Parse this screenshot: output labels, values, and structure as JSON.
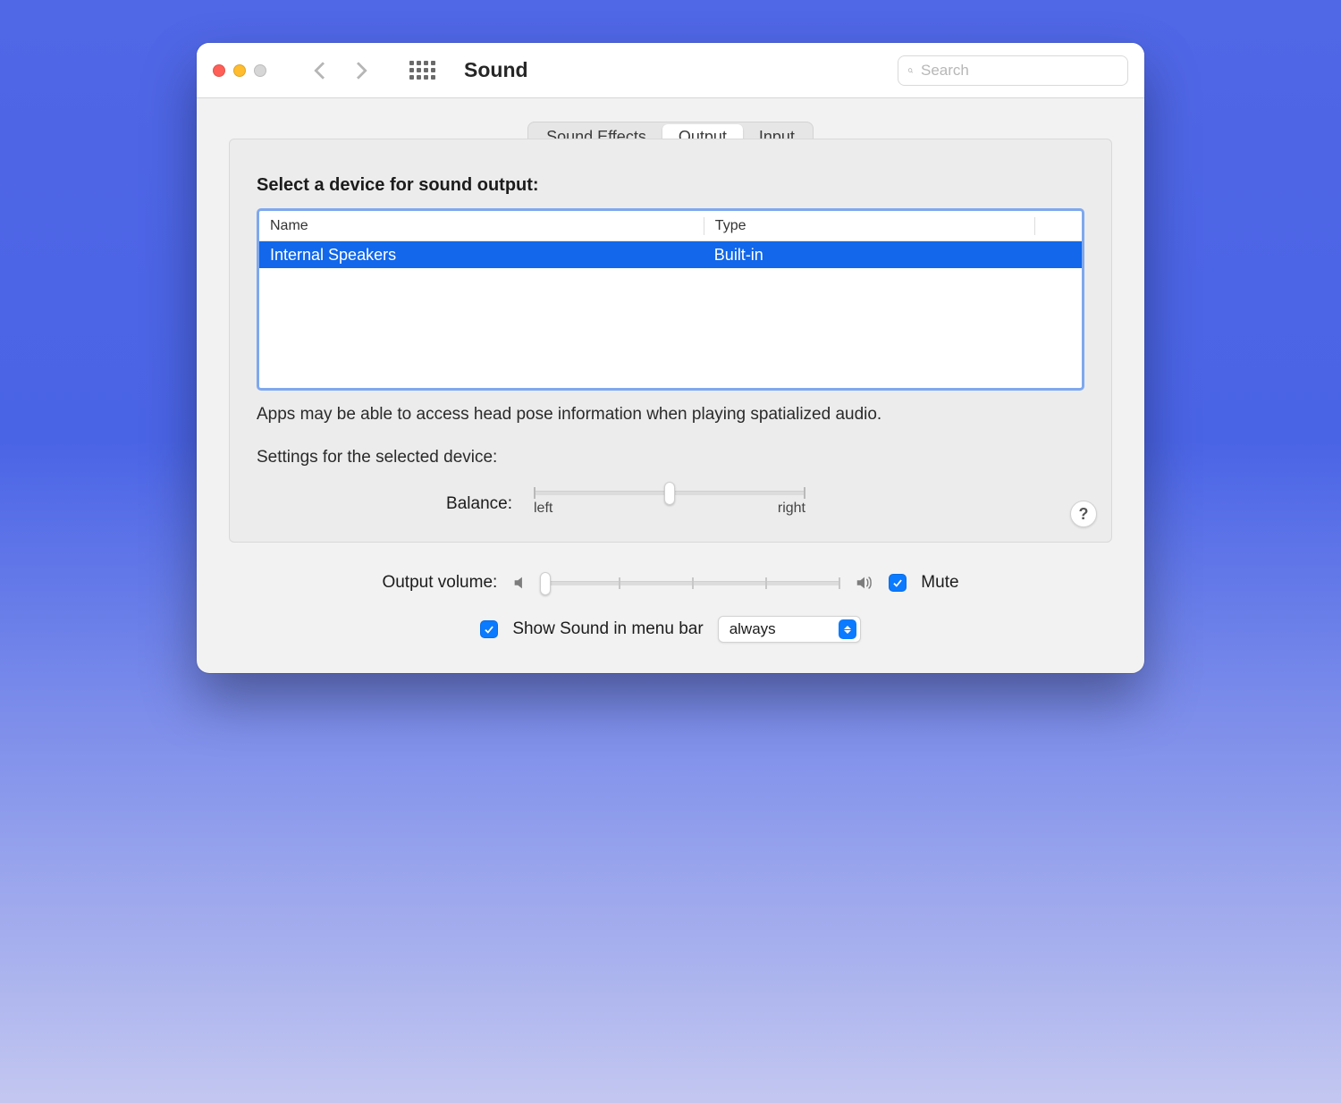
{
  "window": {
    "title": "Sound"
  },
  "search": {
    "placeholder": "Search"
  },
  "tabs": [
    {
      "label": "Sound Effects",
      "active": false
    },
    {
      "label": "Output",
      "active": true
    },
    {
      "label": "Input",
      "active": false
    }
  ],
  "output": {
    "section_title": "Select a device for sound output:",
    "columns": {
      "name": "Name",
      "type": "Type"
    },
    "devices": [
      {
        "name": "Internal Speakers",
        "type": "Built-in",
        "selected": true
      }
    ],
    "hint": "Apps may be able to access head pose information when playing spatialized audio.",
    "settings_title": "Settings for the selected device:",
    "balance": {
      "label": "Balance:",
      "left_label": "left",
      "right_label": "right",
      "value_percent": 50
    }
  },
  "help_label": "?",
  "volume": {
    "label": "Output volume:",
    "value_percent": 0,
    "mute_label": "Mute",
    "mute_checked": true
  },
  "menubar": {
    "checkbox_label": "Show Sound in menu bar",
    "checkbox_checked": true,
    "dropdown_value": "always"
  }
}
